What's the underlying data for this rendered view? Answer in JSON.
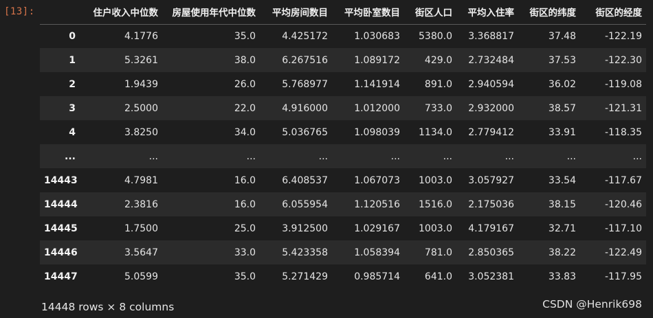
{
  "cell": {
    "prompt": "[13]:"
  },
  "dataframe": {
    "columns": [
      "",
      "住户收入中位数",
      "房屋使用年代中位数",
      "平均房间数目",
      "平均卧室数目",
      "街区人口",
      "平均入住率",
      "街区的纬度",
      "街区的经度"
    ],
    "rows": [
      {
        "index": "0",
        "cells": [
          "4.1776",
          "35.0",
          "4.425172",
          "1.030683",
          "5380.0",
          "3.368817",
          "37.48",
          "-122.19"
        ]
      },
      {
        "index": "1",
        "cells": [
          "5.3261",
          "38.0",
          "6.267516",
          "1.089172",
          "429.0",
          "2.732484",
          "37.53",
          "-122.30"
        ]
      },
      {
        "index": "2",
        "cells": [
          "1.9439",
          "26.0",
          "5.768977",
          "1.141914",
          "891.0",
          "2.940594",
          "36.02",
          "-119.08"
        ]
      },
      {
        "index": "3",
        "cells": [
          "2.5000",
          "22.0",
          "4.916000",
          "1.012000",
          "733.0",
          "2.932000",
          "38.57",
          "-121.31"
        ]
      },
      {
        "index": "4",
        "cells": [
          "3.8250",
          "34.0",
          "5.036765",
          "1.098039",
          "1134.0",
          "2.779412",
          "33.91",
          "-118.35"
        ]
      },
      {
        "index": "...",
        "cells": [
          "...",
          "...",
          "...",
          "...",
          "...",
          "...",
          "...",
          "..."
        ]
      },
      {
        "index": "14443",
        "cells": [
          "4.7981",
          "16.0",
          "6.408537",
          "1.067073",
          "1003.0",
          "3.057927",
          "33.54",
          "-117.67"
        ]
      },
      {
        "index": "14444",
        "cells": [
          "2.3816",
          "16.0",
          "6.055954",
          "1.120516",
          "1516.0",
          "2.175036",
          "38.15",
          "-120.46"
        ]
      },
      {
        "index": "14445",
        "cells": [
          "1.7500",
          "25.0",
          "3.912500",
          "1.029167",
          "1003.0",
          "4.179167",
          "32.71",
          "-117.10"
        ]
      },
      {
        "index": "14446",
        "cells": [
          "3.5647",
          "33.0",
          "5.423358",
          "1.058394",
          "781.0",
          "2.850365",
          "38.22",
          "-122.49"
        ]
      },
      {
        "index": "14447",
        "cells": [
          "5.0599",
          "35.0",
          "5.271429",
          "0.985714",
          "641.0",
          "3.052381",
          "33.83",
          "-117.95"
        ]
      }
    ],
    "shape_text": "14448 rows × 8 columns"
  },
  "watermark": "CSDN @Henrik698"
}
